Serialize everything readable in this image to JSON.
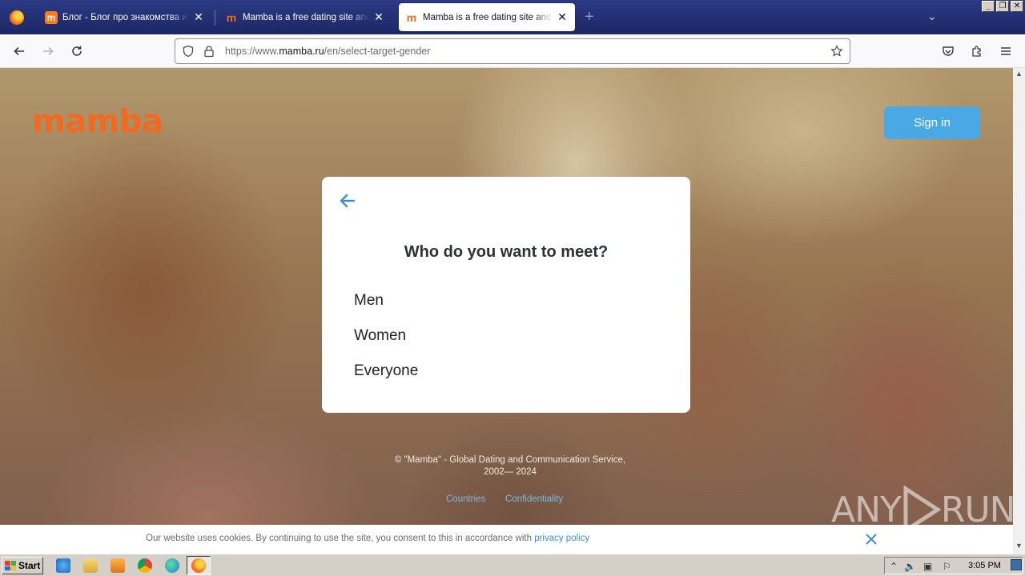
{
  "browser": {
    "tabs": [
      {
        "title": "Блог - Блог про знакомства и отношения",
        "favicon": "m",
        "active": false
      },
      {
        "title": "Mamba is a free dating site and a chat",
        "favicon": "m",
        "active": false
      },
      {
        "title": "Mamba is a free dating site and a chat",
        "favicon": "m",
        "active": true
      }
    ],
    "new_tab_symbol": "+",
    "url_prefix": "https://www.",
    "url_domain": "mamba.ru",
    "url_path": "/en/select-target-gender"
  },
  "page": {
    "logo_text": "mamba",
    "signin_label": "Sign in",
    "card": {
      "title": "Who do you want to meet?",
      "options": [
        "Men",
        "Women",
        "Everyone"
      ]
    },
    "footer": {
      "copyright_line1": "© \"Mamba\" - Global Dating and Communication Service,",
      "copyright_line2": "2002— 2024",
      "link_countries": "Countries",
      "link_confidentiality": "Confidentiality"
    },
    "watermark": {
      "left": "ANY",
      "right": "RUN"
    },
    "cookie": {
      "text": "Our website uses cookies. By continuing to use the site, you consent to this in accordance with ",
      "link": "privacy policy"
    }
  },
  "taskbar": {
    "start_label": "Start",
    "clock": "3:05 PM"
  },
  "colors": {
    "brand_orange": "#f26a21",
    "signin_blue": "#4aa8e4",
    "link_blue": "#3d8fd1",
    "tabstrip": "#1f2a6b"
  }
}
